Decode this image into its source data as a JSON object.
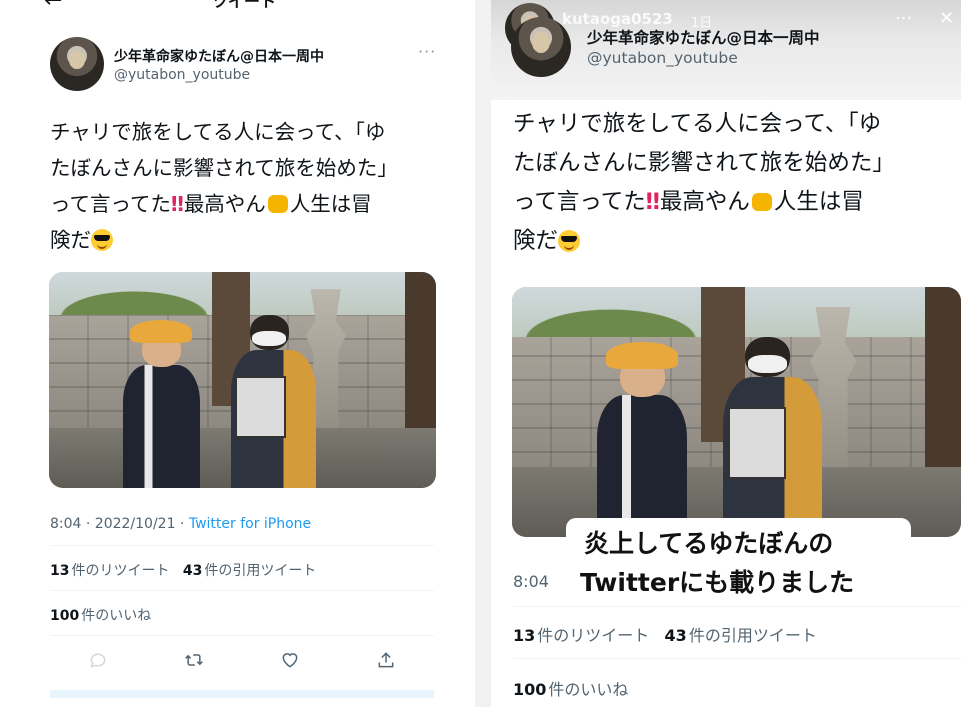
{
  "left": {
    "nav": {
      "back_icon": "←",
      "title": "ツイート"
    },
    "author": {
      "name": "少年革命家ゆたぼん@日本一周中",
      "handle": "@yutabon_youtube",
      "more": "···"
    },
    "text": {
      "line1": "チャリで旅をしてる人に会って、「ゆ",
      "line2": "たぼんさんに影響されて旅を始めた」",
      "line3a": "って言ってた",
      "emoji_bang": "‼",
      "line3b": "最高やん",
      "line3c": "人生は冒",
      "line4": "険だ"
    },
    "timestamp": "8:04 · 2022/10/21 · ",
    "client": "Twitter for iPhone",
    "stats": {
      "retweets_count": "13",
      "retweets_label": "件のリツイート",
      "quotes_count": "43",
      "quotes_label": "件の引用ツイート",
      "likes_count": "100",
      "likes_label": "件のいいね"
    },
    "actions": [
      "reply-icon",
      "retweet-icon",
      "like-icon",
      "share-icon"
    ]
  },
  "right": {
    "story": {
      "username": "kutaoga0523",
      "time": "1日",
      "more": "···",
      "close": "✕"
    },
    "author": {
      "name": "少年革命家ゆたぼん@日本一周中",
      "handle": "@yutabon_youtube"
    },
    "text": {
      "line1": "チャリで旅をしてる人に会って、「ゆ",
      "line2": "たぼんさんに影響されて旅を始めた」",
      "line3a": "って言ってた",
      "emoji_bang": "‼",
      "line3b": "最高やん",
      "line3c": "人生は冒",
      "line4": "険だ"
    },
    "timestamp_partial": "8:04",
    "caption": {
      "line1": "炎上してるゆたぼんの",
      "line2": "Twitterにも載りました"
    },
    "stats": {
      "retweets_count": "13",
      "retweets_label": "件のリツイート",
      "quotes_count": "43",
      "quotes_label": "件の引用ツイート",
      "likes_count": "100",
      "likes_label": "件のいいね"
    }
  },
  "colors": {
    "link": "#1d9bf0",
    "secondary": "#536471",
    "text": "#0f1419"
  }
}
